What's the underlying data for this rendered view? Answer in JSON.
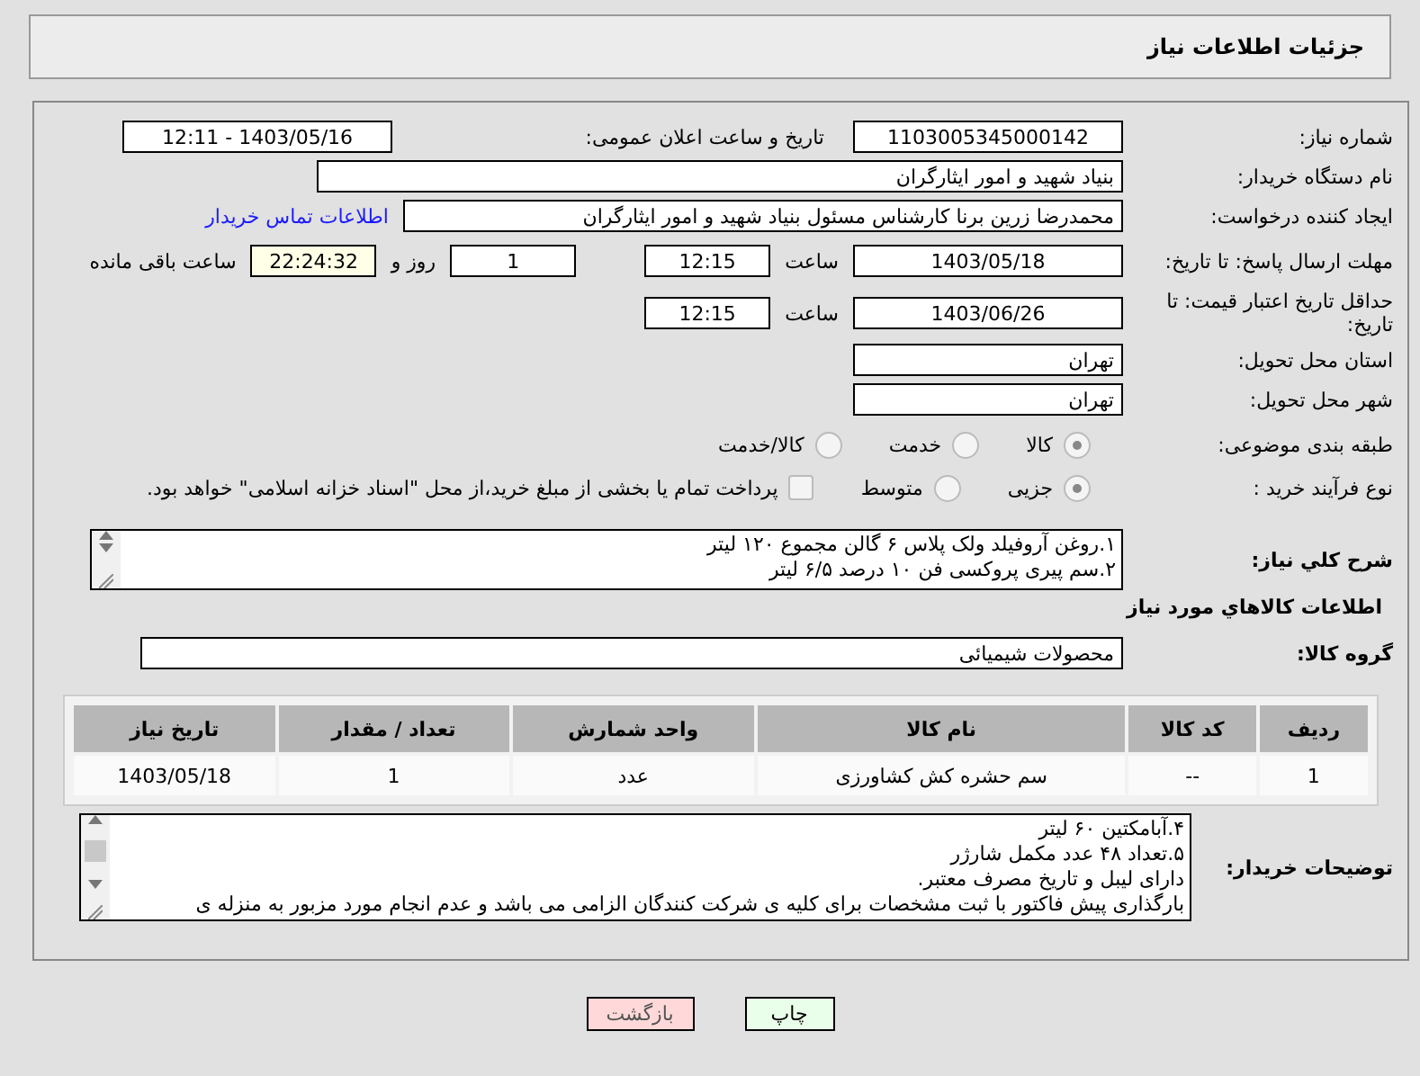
{
  "header": {
    "title": "جزئیات اطلاعات نیاز"
  },
  "need_number": {
    "label": "شماره نیاز:",
    "value": "1103005345000142"
  },
  "announce": {
    "label": "تاریخ و ساعت اعلان عمومی:",
    "value": "1403/05/16 - 12:11"
  },
  "buyer_org": {
    "label": "نام دستگاه خریدار:",
    "value": "بنیاد شهید و امور ایثارگران"
  },
  "requester": {
    "label": "ایجاد کننده درخواست:",
    "value": "محمدرضا زرین برنا کارشناس مسئول  بنیاد شهید و امور ایثارگران",
    "link": "اطلاعات تماس خریدار"
  },
  "deadline": {
    "label": "مهلت ارسال پاسخ: تا تاریخ:",
    "date": "1403/05/18",
    "time_label": "ساعت",
    "time": "12:15",
    "days": "1",
    "days_label": "روز و",
    "remaining": "22:24:32",
    "remaining_label": "ساعت باقی مانده"
  },
  "validity": {
    "label": "حداقل تاریخ اعتبار قیمت: تا تاریخ:",
    "date": "1403/06/26",
    "time_label": "ساعت",
    "time": "12:15"
  },
  "province": {
    "label": "استان محل تحویل:",
    "value": "تهران"
  },
  "city": {
    "label": "شهر محل تحویل:",
    "value": "تهران"
  },
  "category": {
    "label": "طبقه بندی موضوعی:",
    "options": [
      {
        "label": "کالا",
        "selected": true
      },
      {
        "label": "خدمت",
        "selected": false
      },
      {
        "label": "کالا/خدمت",
        "selected": false
      }
    ]
  },
  "process": {
    "label": "نوع فرآیند خرید :",
    "options": [
      {
        "label": "جزیی",
        "selected": true
      },
      {
        "label": "متوسط",
        "selected": false
      }
    ],
    "treasury": {
      "label": "پرداخت تمام یا بخشی از مبلغ خرید،از محل \"اسناد خزانه اسلامی\" خواهد بود.",
      "checked": false
    }
  },
  "description": {
    "label": "شرح كلي نیاز:",
    "lines": [
      "۱.روغن آروفیلد ولک پلاس ۶ گالن مجموع ۱۲۰ لیتر",
      "۲.سم پیری پروکسی فن ۱۰ درصد ۶/۵ لیتر"
    ]
  },
  "goods_heading": "اطلاعات كالاهاي مورد نیاز",
  "goods_group": {
    "label": "گروه کالا:",
    "value": "محصولات شیمیائی"
  },
  "table": {
    "columns": [
      "ردیف",
      "کد کالا",
      "نام کالا",
      "واحد شمارش",
      "تعداد / مقدار",
      "تاریخ نیاز"
    ],
    "rows": [
      [
        "1",
        "--",
        "سم حشره کش کشاورزی",
        "عدد",
        "1",
        "1403/05/18"
      ]
    ]
  },
  "buyer_notes": {
    "label": "توضیحات خریدار:",
    "lines": [
      "۴.آبامکتین ۶۰ لیتر",
      "۵.تعداد ۴۸ عدد مکمل شارژر",
      "دارای لیبل و تاریخ مصرف معتبر.",
      "بارگذاری پیش فاکتور با ثبت مشخصات برای کلیه ی شرکت کنندگان الزامی می باشد و عدم انجام مورد مزبور به منزله ی"
    ]
  },
  "buttons": [
    {
      "label": "چاپ",
      "kind": "print"
    },
    {
      "label": "بازگشت",
      "kind": "back"
    }
  ]
}
